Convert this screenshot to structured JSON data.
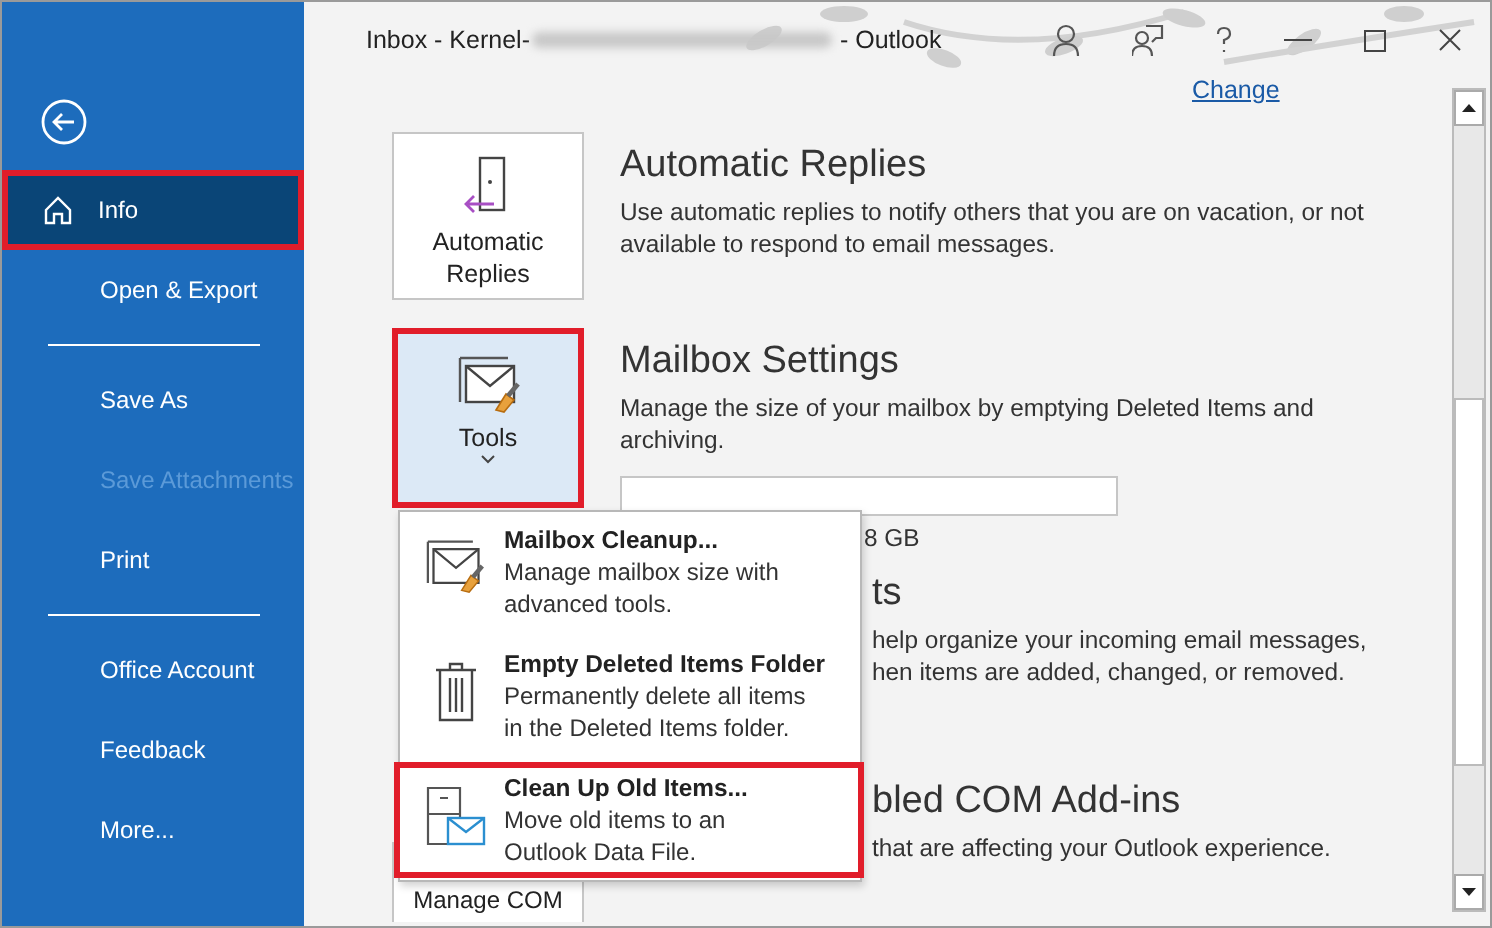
{
  "window": {
    "title_prefix": "Inbox - Kernel-",
    "title_suffix": "- Outlook"
  },
  "sidebar": {
    "items": [
      {
        "label": "Info",
        "kind": "home",
        "selected": true,
        "highlighted": true,
        "disabled": false,
        "divider_after": false
      },
      {
        "label": "Open & Export",
        "kind": "plain",
        "selected": false,
        "highlighted": false,
        "disabled": false,
        "divider_after": true
      },
      {
        "label": "Save As",
        "kind": "plain",
        "selected": false,
        "highlighted": false,
        "disabled": false,
        "divider_after": false
      },
      {
        "label": "Save Attachments",
        "kind": "plain",
        "selected": false,
        "highlighted": false,
        "disabled": true,
        "divider_after": false
      },
      {
        "label": "Print",
        "kind": "plain",
        "selected": false,
        "highlighted": false,
        "disabled": false,
        "divider_after": true
      },
      {
        "label": "Office Account",
        "kind": "plain",
        "selected": false,
        "highlighted": false,
        "disabled": false,
        "divider_after": false
      },
      {
        "label": "Feedback",
        "kind": "plain",
        "selected": false,
        "highlighted": false,
        "disabled": false,
        "divider_after": false
      },
      {
        "label": "More...",
        "kind": "plain",
        "selected": false,
        "highlighted": false,
        "disabled": false,
        "divider_after": false
      }
    ]
  },
  "account_link": "Change",
  "sections": [
    {
      "kind": "full",
      "button": {
        "label": "Automatic\nReplies",
        "highlighted": false,
        "dropdown": false
      },
      "heading": "Automatic Replies",
      "description": "Use automatic replies to notify others that you are on vacation, or not\navailable to respond to email messages."
    },
    {
      "kind": "full",
      "button": {
        "label": "Tools",
        "highlighted": true,
        "dropdown": true
      },
      "heading": "Mailbox Settings",
      "description": "Manage the size of your mailbox by emptying Deleted Items and\narchiving.",
      "storage": {
        "reading": "8 GB"
      }
    },
    {
      "kind": "covered",
      "heading": "ts",
      "description": "help organize your incoming email messages,\nhen items are added, changed, or removed."
    },
    {
      "kind": "covered",
      "heading": "bled COM Add-ins",
      "description": "that are affecting your Outlook experience.",
      "button": {
        "label": "Manage COM",
        "highlighted": false
      }
    }
  ],
  "tools_menu": {
    "items": [
      {
        "title": "Mailbox Cleanup...",
        "description": "Manage mailbox size with\nadvanced tools.",
        "highlighted": false
      },
      {
        "title": "Empty Deleted Items Folder",
        "description": "Permanently delete all items\nin the Deleted Items folder.",
        "highlighted": false
      },
      {
        "title": "Clean Up Old Items...",
        "description": "Move old items to an\nOutlook Data File.",
        "highlighted": true
      }
    ]
  }
}
